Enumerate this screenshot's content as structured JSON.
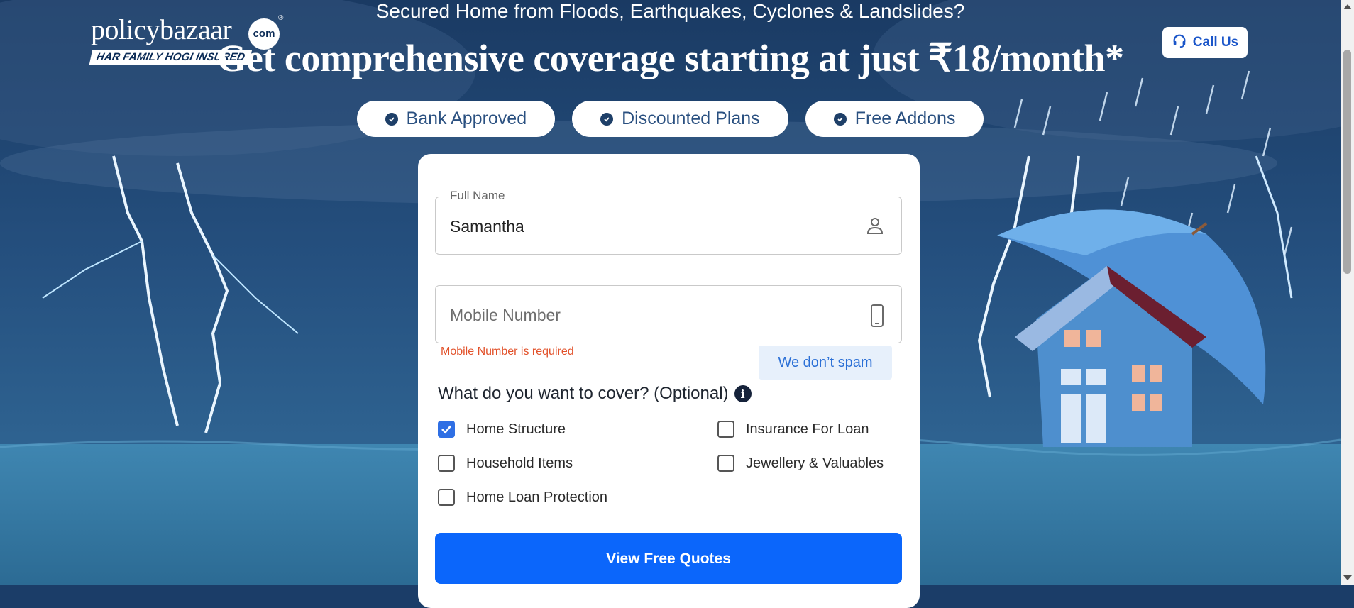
{
  "header": {
    "logo": {
      "brand": "policybazaar",
      "com": "com",
      "tagline": "HAR FAMILY HOGI INSURED"
    },
    "tagline": "Secured Home from Floods, Earthquakes, Cyclones & Landslides?",
    "headline": "Get comprehensive coverage starting at just ₹18/month*",
    "call_us": "Call Us"
  },
  "badges": [
    {
      "label": "Bank Approved",
      "icon": "check-circle-icon"
    },
    {
      "label": "Discounted Plans",
      "icon": "check-circle-icon"
    },
    {
      "label": "Free Addons",
      "icon": "check-circle-icon"
    }
  ],
  "form": {
    "full_name": {
      "label": "Full Name",
      "value": "Samantha",
      "icon": "user-icon"
    },
    "mobile": {
      "placeholder": "Mobile Number",
      "icon": "mobile-phone-icon",
      "error": "Mobile Number is required",
      "note": "We don’t spam"
    },
    "cover_question": "What do you want to cover? (Optional)",
    "options": [
      {
        "label": "Home Structure",
        "checked": true
      },
      {
        "label": "Insurance For Loan",
        "checked": false
      },
      {
        "label": "Household Items",
        "checked": false
      },
      {
        "label": "Jewellery & Valuables",
        "checked": false
      },
      {
        "label": "Home Loan Protection",
        "checked": false
      }
    ],
    "submit": "View Free Quotes"
  },
  "colors": {
    "primary": "#0b66fb",
    "error": "#e2522b",
    "badge_text": "#2a5080"
  }
}
